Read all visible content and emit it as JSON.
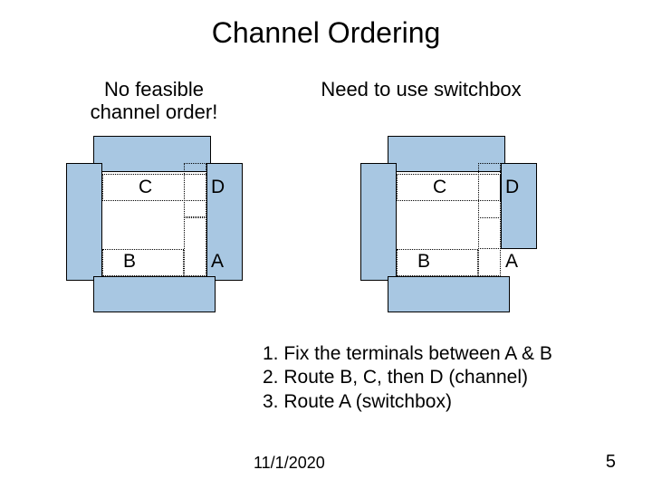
{
  "title": "Channel Ordering",
  "captions": {
    "left_line1": "No feasible",
    "left_line2": "channel order!",
    "right": "Need to use switchbox"
  },
  "labels": {
    "A": "A",
    "B": "B",
    "C": "C",
    "D": "D"
  },
  "steps": {
    "s1": "1. Fix the terminals between A & B",
    "s2": "2. Route B, C, then D (channel)",
    "s3": "3. Route A (switchbox)"
  },
  "footer": {
    "date": "11/1/2020",
    "page": "5"
  }
}
